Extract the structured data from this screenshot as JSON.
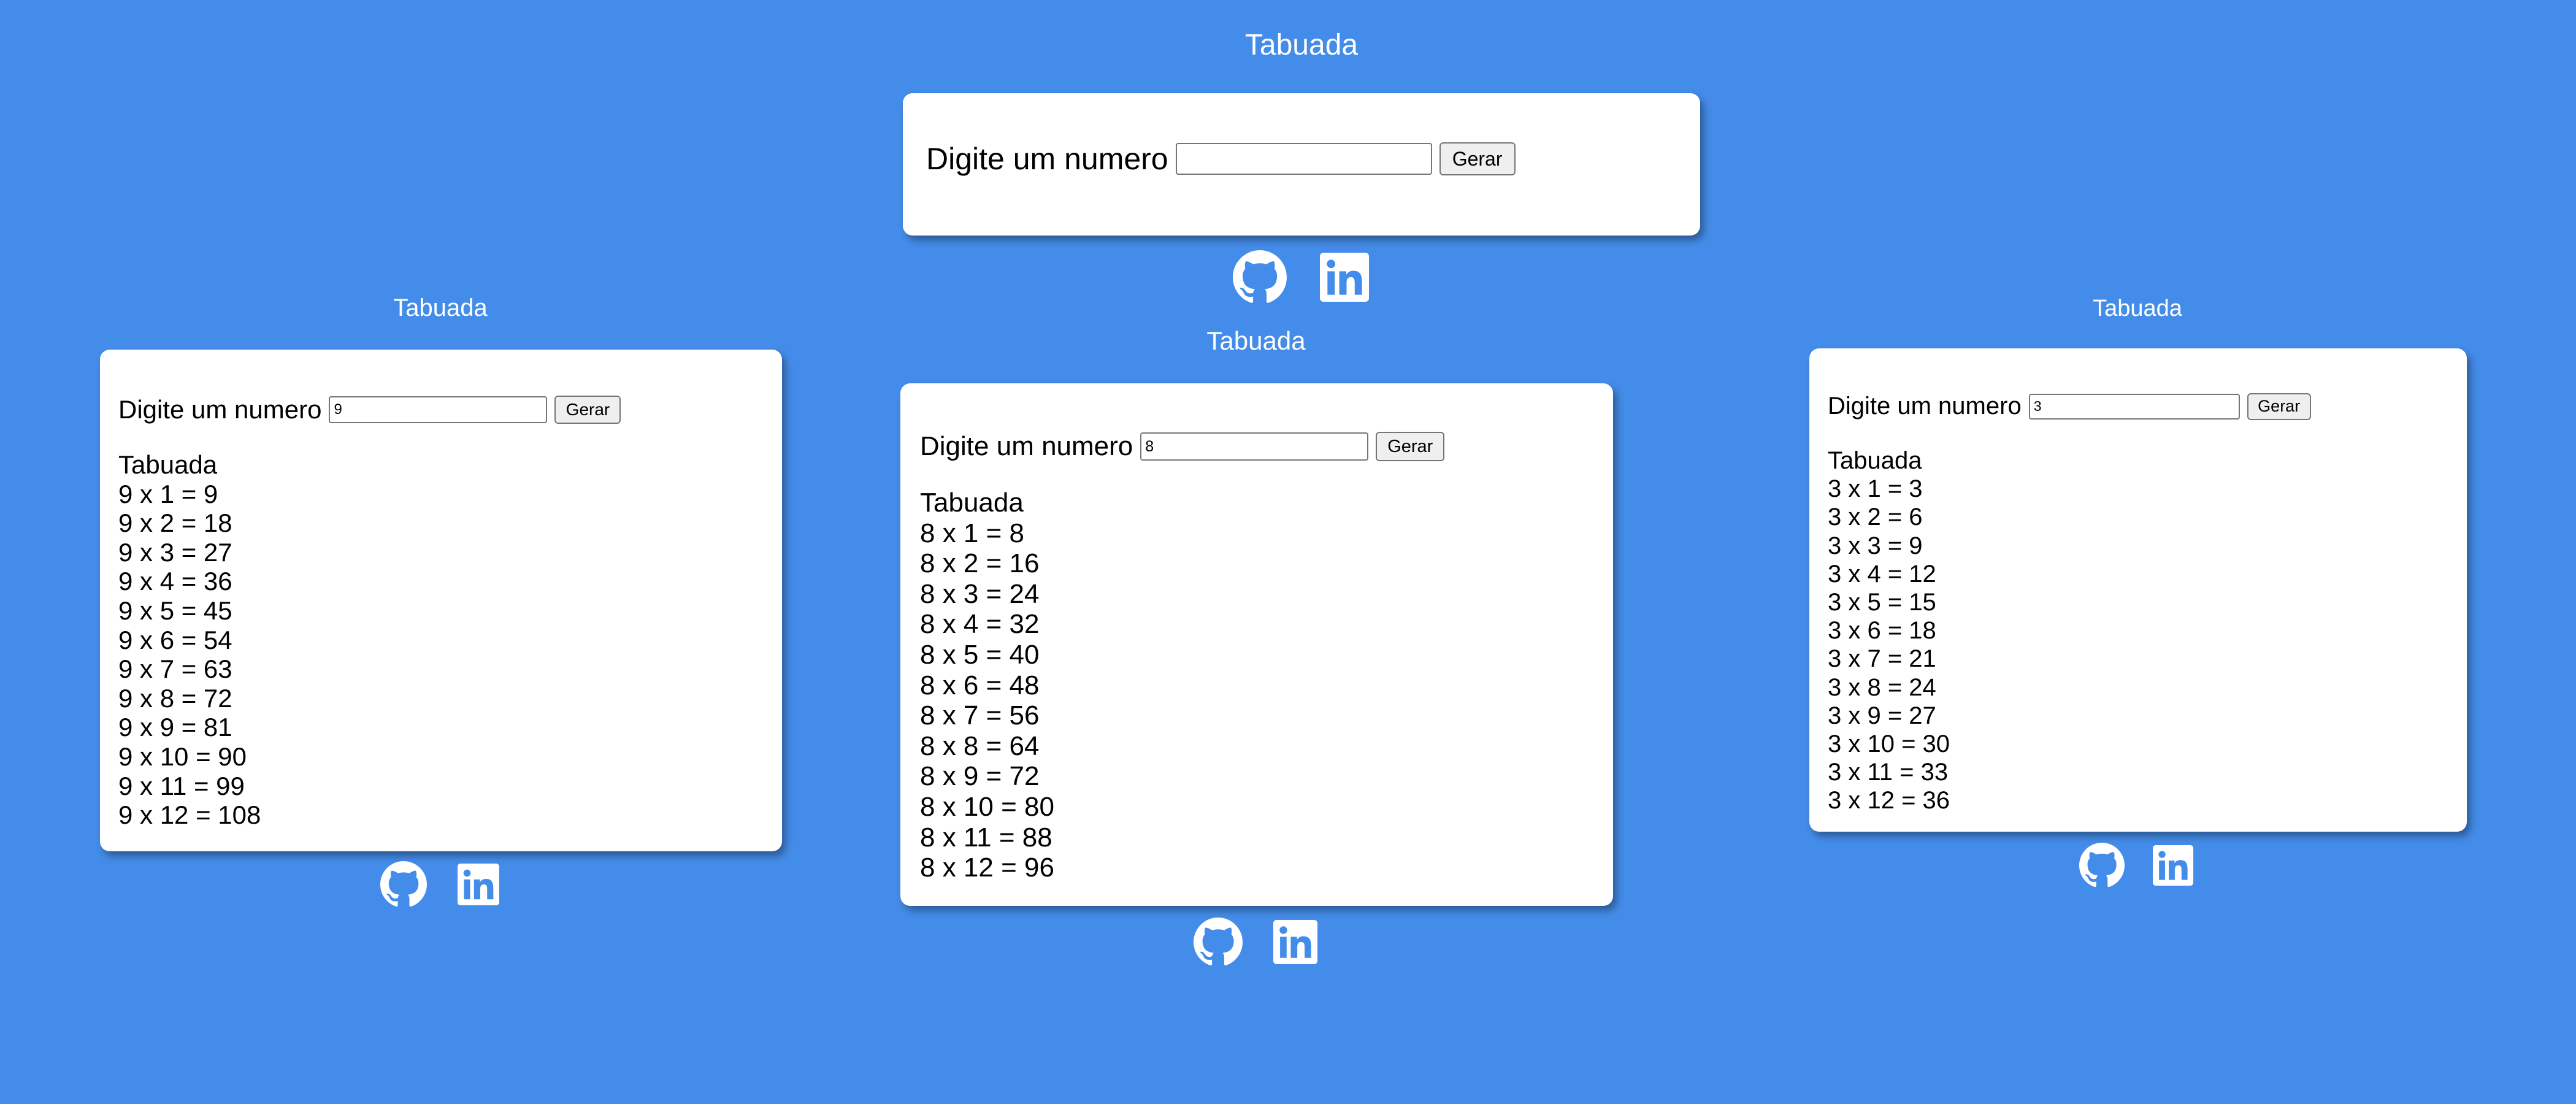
{
  "app": {
    "heading": "Tabuada",
    "form_label": "Digite um numero",
    "button_label": "Gerar"
  },
  "instances": [
    {
      "id": "top",
      "input_value": "",
      "result_title": "",
      "rows": []
    },
    {
      "id": "left",
      "input_value": "9",
      "result_title": "Tabuada",
      "rows": [
        "9 x 1 = 9",
        "9 x 2 = 18",
        "9 x 3 = 27",
        "9 x 4 = 36",
        "9 x 5 = 45",
        "9 x 6 = 54",
        "9 x 7 = 63",
        "9 x 8 = 72",
        "9 x 9 = 81",
        "9 x 10 = 90",
        "9 x 11 = 99",
        "9 x 12 = 108"
      ]
    },
    {
      "id": "middle",
      "input_value": "8",
      "result_title": "Tabuada",
      "rows": [
        "8 x 1 = 8",
        "8 x 2 = 16",
        "8 x 3 = 24",
        "8 x 4 = 32",
        "8 x 5 = 40",
        "8 x 6 = 48",
        "8 x 7 = 56",
        "8 x 8 = 64",
        "8 x 9 = 72",
        "8 x 10 = 80",
        "8 x 11 = 88",
        "8 x 12 = 96"
      ]
    },
    {
      "id": "right",
      "input_value": "3",
      "result_title": "Tabuada",
      "rows": [
        "3 x 1 = 3",
        "3 x 2 = 6",
        "3 x 3 = 9",
        "3 x 4 = 12",
        "3 x 5 = 15",
        "3 x 6 = 18",
        "3 x 7 = 21",
        "3 x 8 = 24",
        "3 x 9 = 27",
        "3 x 10 = 30",
        "3 x 11 = 33",
        "3 x 12 = 36"
      ]
    }
  ],
  "social_icons": [
    "github-icon",
    "linkedin-icon"
  ],
  "colors": {
    "background": "#458dea",
    "card": "#ffffff",
    "heading_text": "#ffffff",
    "icon": "#ffffff"
  }
}
